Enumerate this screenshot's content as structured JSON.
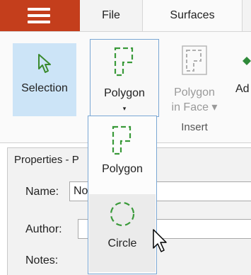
{
  "tabs": {
    "file": "File",
    "surfaces": "Surfaces"
  },
  "ribbon": {
    "selection_label": "Selection",
    "polygon_label": "Polygon",
    "polygon_in_face_line1": "Polygon",
    "polygon_in_face_line2": "in Face ▾",
    "truncated_button_label": "Ad",
    "group_label": "Insert",
    "dropdown_arrow": "▾"
  },
  "dropdown": {
    "items": [
      {
        "label": "Polygon",
        "icon": "dashed-polygon-icon"
      },
      {
        "label": "Circle",
        "icon": "dashed-circle-icon"
      }
    ]
  },
  "properties": {
    "title": "Properties - P",
    "name_label": "Name:",
    "name_value": "No",
    "author_label": "Author:",
    "author_value": "",
    "notes_label": "Notes:"
  },
  "colors": {
    "app_accent": "#c43e1c",
    "selected_button": "#cce4f7",
    "focus_border": "#7aa7d4",
    "icon_green": "#4a9a3e"
  }
}
